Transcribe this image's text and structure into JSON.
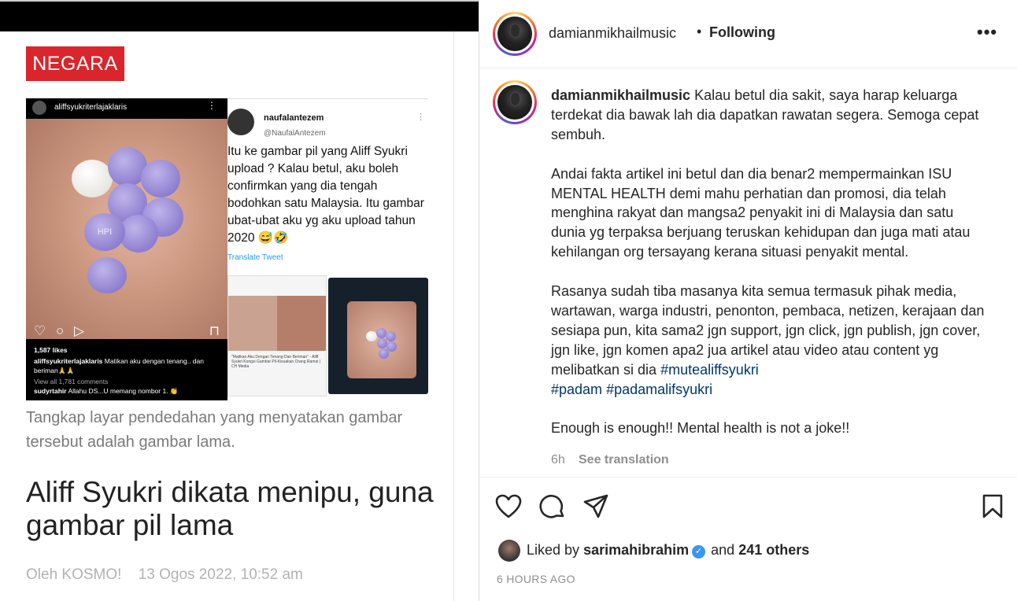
{
  "article": {
    "section": "NEGARA",
    "embed_photo": {
      "username": "aliffsyukriterlajaklaris",
      "likes": "1,587 likes",
      "caption_user": "aliffsyukriterlajaklaris",
      "caption_text": "Matikan aku dengan tenang.. dan beriman🙏🙏",
      "view_comments": "View all 1,781 comments",
      "comment_user": "sudyrtahir",
      "comment_text": "Allahu DS...U memang nombor 1. 👏",
      "pill_imprint": "HPI"
    },
    "embed_tweet": {
      "name": "naufalantezem",
      "handle": "@NaufalAntezem",
      "text": "Itu ke gambar pil yang Aliff Syukri upload ? Kalau betul, aku boleh confirmkan yang dia tengah bodohkan satu Malaysia. Itu gambar ubat-ubat aku yg aku upload tahun 2020 😅🤣",
      "translate": "Translate Tweet",
      "card_title": "\"Matikan Aku Dengan Tenang Dan Beriman\" - Aliff Syukri Kongsi Gambar Pil-Kisuakan Orang Ramai | CH Media"
    },
    "caption": "Tangkap layar pendedahan yang menyatakan gambar tersebut adalah gambar lama.",
    "headline": "Aliff Syukri dikata menipu, guna gambar pil lama",
    "byline": "Oleh KOSMO!",
    "date": "13 Ogos 2022, 10:52 am"
  },
  "post": {
    "username": "damianmikhailmusic",
    "separator": "•",
    "follow_status": "Following",
    "more": "•••",
    "caption_user": "damianmikhailmusic",
    "paragraph1": "Kalau betul dia sakit, saya harap keluarga terdekat dia bawak lah dia dapatkan rawatan segera. Semoga cepat sembuh.",
    "paragraph2": "Andai fakta artikel ini betul dan dia benar2 mempermainkan ISU MENTAL HEALTH demi mahu perhatian dan promosi, dia telah menghina rakyat dan mangsa2 penyakit ini di Malaysia dan satu dunia yg terpaksa berjuang teruskan kehidupan dan juga mati atau kehilangan org tersayang kerana situasi penyakit mental.",
    "paragraph3": "Rasanya sudah tiba masanya kita semua termasuk pihak media, wartawan, warga industri, penonton, pembaca, netizen, kerajaan dan sesiapa pun, kita sama2 jgn support, jgn click, jgn publish, jgn cover, jgn like, jgn komen apa2 jua artikel atau video atau content yg melibatkan si dia",
    "hashtags": [
      "#mutealiffsyukri",
      "#padam",
      "#padamalifsyukri"
    ],
    "paragraph4": "Enough is enough!! Mental health is not a joke!!",
    "time": "6h",
    "see_translation": "See translation",
    "liked_prefix": "Liked by",
    "liked_user": "sarimahibrahim",
    "liked_and": "and",
    "liked_others": "241 others",
    "ago": "6 HOURS AGO"
  },
  "colors": {
    "section_red": "#d9252b",
    "hashtag": "#00376b",
    "verified": "#3897f0"
  }
}
